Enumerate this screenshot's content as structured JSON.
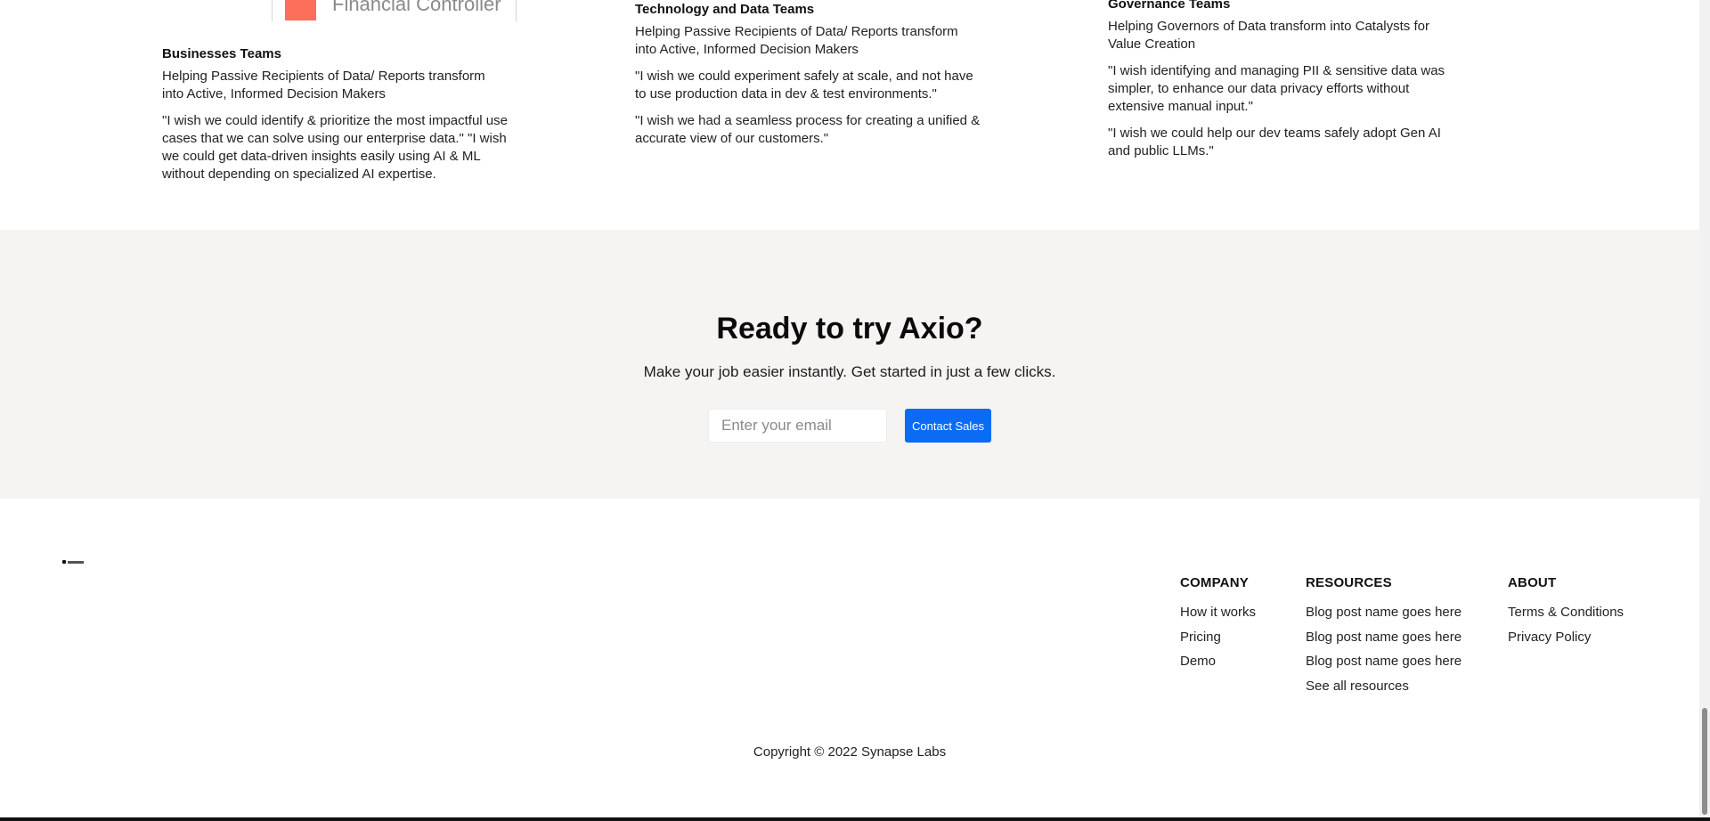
{
  "logo_card": {
    "text": "Financial Controller",
    "accent_color": "#fa6e5a"
  },
  "teams": [
    {
      "title": "Businesses Teams",
      "description": "Helping Passive Recipients of Data/ Reports transform into Active, Informed Decision Makers",
      "quotes": [
        "\"I wish we could identify & prioritize the most impactful use cases that we can solve using our enterprise data.\" \"I wish we could get data-driven insights easily using AI & ML without depending on specialized AI expertise."
      ]
    },
    {
      "title": "Technology and Data Teams",
      "description": "Helping Passive Recipients of Data/ Reports transform into Active, Informed Decision Makers",
      "quotes": [
        "\"I wish we could experiment safely at scale, and not have to use production data in dev & test environments.\"",
        "\"I wish we had a seamless process for creating a unified & accurate view of our customers.\""
      ]
    },
    {
      "title": "Governance Teams",
      "description": "Helping Governors of Data transform into Catalysts for Value Creation",
      "quotes": [
        "\"I wish identifying and managing PII & sensitive data was simpler, to enhance our data privacy efforts without extensive manual input.\"",
        "\"I wish we could help our dev teams safely adopt Gen AI and public LLMs.\""
      ]
    }
  ],
  "cta": {
    "title": "Ready to try Axio?",
    "subtitle": "Make your job easier instantly. Get started in just a few clicks.",
    "email_placeholder": "Enter your email",
    "button_label": "Contact Sales",
    "button_color": "#0a6cf5",
    "background_color": "#f5f4f2"
  },
  "footer": {
    "columns": [
      {
        "title": "COMPANY",
        "items": [
          "How it works",
          "Pricing",
          "Demo"
        ]
      },
      {
        "title": "RESOURCES",
        "items": [
          "Blog post name goes here",
          "Blog post name goes here",
          "Blog post name goes here",
          "See all resources"
        ]
      },
      {
        "title": "ABOUT",
        "items": [
          "Terms & Conditions",
          "Privacy Policy"
        ]
      }
    ],
    "copyright": "Copyright © 2022 Synapse Labs"
  }
}
